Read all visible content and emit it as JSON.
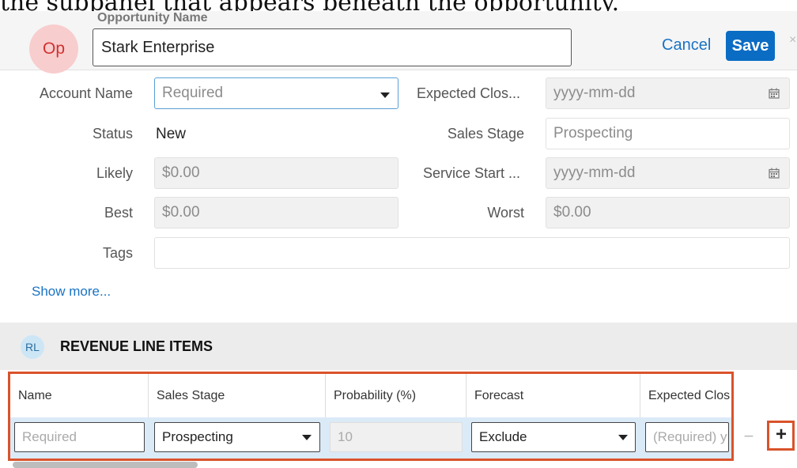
{
  "caption_fragment": "the subpanel that appears beneath the opportunity.",
  "header": {
    "avatar_text": "Op",
    "opportunity_label": "Opportunity Name",
    "opportunity_value": "Stark Enterprise",
    "cancel_label": "Cancel",
    "save_label": "Save",
    "close_glyph": "×"
  },
  "form": {
    "account_name": {
      "label": "Account Name",
      "placeholder": "Required"
    },
    "expected_close": {
      "label": "Expected Clos...",
      "placeholder": "yyyy-mm-dd"
    },
    "status": {
      "label": "Status",
      "value": "New"
    },
    "sales_stage": {
      "label": "Sales Stage",
      "value": "Prospecting"
    },
    "likely": {
      "label": "Likely",
      "value": "$0.00"
    },
    "service_start": {
      "label": "Service Start ...",
      "placeholder": "yyyy-mm-dd"
    },
    "best": {
      "label": "Best",
      "value": "$0.00"
    },
    "worst": {
      "label": "Worst",
      "value": "$0.00"
    },
    "tags": {
      "label": "Tags",
      "value": ""
    },
    "show_more": "Show more..."
  },
  "revenue_line_items": {
    "badge": "RL",
    "title": "REVENUE LINE ITEMS",
    "columns": [
      "Name",
      "Sales Stage",
      "Probability (%)",
      "Forecast",
      "Expected Clos"
    ],
    "row": {
      "name_placeholder": "Required",
      "sales_stage": "Prospecting",
      "probability": "10",
      "forecast": "Exclude",
      "expected_close_placeholder": "(Required) y"
    },
    "minus_glyph": "−",
    "plus_glyph": "+"
  },
  "colors": {
    "accent": "#0b6cc4",
    "link": "#1a73c4",
    "highlight": "#d9532b",
    "avatar_bg": "#f8cdcd"
  }
}
